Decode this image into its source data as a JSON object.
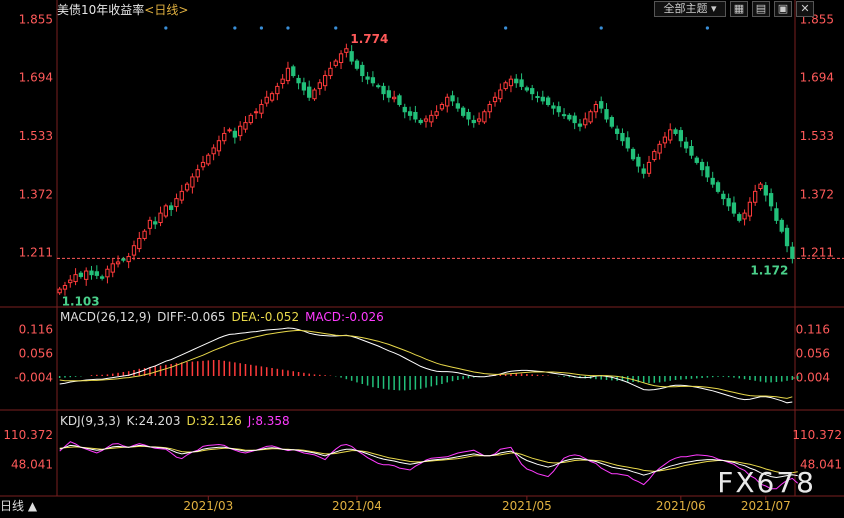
{
  "header": {
    "title": "美债10年收益率",
    "period": "<日线>"
  },
  "toolbar": {
    "dropdown_label": "全部主题",
    "icons": [
      "grid-icon",
      "list-icon",
      "expand-icon",
      "close-icon"
    ]
  },
  "colors": {
    "up": "#ff3b3b",
    "down": "#22c07a",
    "diff": "#ffffff",
    "dea": "#e8d84a",
    "macd": "#ff3bff",
    "k": "#ffffff",
    "d": "#e8d84a",
    "j": "#ff3bff",
    "dashed": "#ff5a5a",
    "marker": "#3a8fd8"
  },
  "macd": {
    "title": "MACD(26,12,9)",
    "diff_label": "DIFF:-0.065",
    "dea_label": "DEA:-0.052",
    "macd_label": "MACD:-0.026"
  },
  "kdj": {
    "title": "KDJ(9,3,3)",
    "k_label": "K:24.203",
    "d_label": "D:32.126",
    "j_label": "J:8.358"
  },
  "footer": {
    "label": "日线 ▲"
  },
  "watermark": "FX678",
  "chart_data": {
    "type": "candlestick",
    "title": "美债10年收益率",
    "y_ticks": [
      "1.855",
      "1.694",
      "1.533",
      "1.372",
      "1.211"
    ],
    "ylim": [
      1.08,
      1.87
    ],
    "x_tick_labels": [
      "2021/03",
      "2021/04",
      "2021/05",
      "2021/06",
      "2021/07"
    ],
    "high_label": "1.774",
    "low_label": "1.103",
    "last_label": "1.172",
    "last_value": 1.195,
    "closes": [
      1.11,
      1.12,
      1.135,
      1.15,
      1.145,
      1.16,
      1.15,
      1.148,
      1.14,
      1.165,
      1.18,
      1.185,
      1.19,
      1.2,
      1.23,
      1.25,
      1.27,
      1.3,
      1.29,
      1.32,
      1.34,
      1.33,
      1.36,
      1.38,
      1.4,
      1.42,
      1.44,
      1.46,
      1.48,
      1.5,
      1.52,
      1.54,
      1.55,
      1.53,
      1.56,
      1.57,
      1.59,
      1.6,
      1.62,
      1.64,
      1.65,
      1.67,
      1.69,
      1.72,
      1.7,
      1.68,
      1.66,
      1.64,
      1.66,
      1.68,
      1.7,
      1.72,
      1.74,
      1.76,
      1.774,
      1.74,
      1.72,
      1.7,
      1.69,
      1.68,
      1.67,
      1.65,
      1.64,
      1.64,
      1.62,
      1.6,
      1.59,
      1.58,
      1.57,
      1.58,
      1.59,
      1.6,
      1.62,
      1.64,
      1.63,
      1.61,
      1.59,
      1.58,
      1.57,
      1.58,
      1.6,
      1.62,
      1.64,
      1.66,
      1.68,
      1.69,
      1.68,
      1.67,
      1.66,
      1.65,
      1.64,
      1.63,
      1.62,
      1.61,
      1.6,
      1.59,
      1.58,
      1.57,
      1.56,
      1.58,
      1.6,
      1.62,
      1.61,
      1.58,
      1.56,
      1.54,
      1.52,
      1.5,
      1.47,
      1.45,
      1.43,
      1.46,
      1.49,
      1.51,
      1.53,
      1.55,
      1.54,
      1.52,
      1.5,
      1.48,
      1.46,
      1.44,
      1.42,
      1.4,
      1.38,
      1.36,
      1.34,
      1.32,
      1.3,
      1.32,
      1.35,
      1.38,
      1.4,
      1.37,
      1.34,
      1.3,
      1.27,
      1.23,
      1.195
    ],
    "macd_y_ticks": [
      "0.116",
      "0.056",
      "-0.004"
    ],
    "macd_ylim": [
      -0.07,
      0.135
    ],
    "macd_diff": [
      -0.02,
      -0.018,
      -0.015,
      -0.013,
      -0.012,
      -0.01,
      -0.009,
      -0.008,
      -0.008,
      -0.006,
      -0.004,
      -0.002,
      0.0,
      0.002,
      0.006,
      0.01,
      0.015,
      0.021,
      0.025,
      0.031,
      0.037,
      0.041,
      0.047,
      0.053,
      0.059,
      0.065,
      0.071,
      0.077,
      0.083,
      0.089,
      0.095,
      0.1,
      0.104,
      0.105,
      0.107,
      0.108,
      0.11,
      0.111,
      0.113,
      0.115,
      0.116,
      0.117,
      0.118,
      0.12,
      0.119,
      0.116,
      0.112,
      0.107,
      0.104,
      0.102,
      0.101,
      0.1,
      0.1,
      0.101,
      0.102,
      0.099,
      0.095,
      0.09,
      0.085,
      0.08,
      0.075,
      0.069,
      0.063,
      0.058,
      0.052,
      0.045,
      0.038,
      0.031,
      0.024,
      0.019,
      0.015,
      0.012,
      0.011,
      0.011,
      0.01,
      0.008,
      0.005,
      0.002,
      -0.001,
      -0.002,
      -0.002,
      0.0,
      0.002,
      0.005,
      0.009,
      0.012,
      0.013,
      0.014,
      0.014,
      0.013,
      0.012,
      0.011,
      0.009,
      0.007,
      0.005,
      0.003,
      0.001,
      -0.002,
      -0.004,
      -0.004,
      -0.003,
      0.0,
      0.001,
      -0.001,
      -0.003,
      -0.007,
      -0.011,
      -0.016,
      -0.022,
      -0.028,
      -0.034,
      -0.035,
      -0.034,
      -0.032,
      -0.029,
      -0.025,
      -0.023,
      -0.023,
      -0.024,
      -0.026,
      -0.028,
      -0.031,
      -0.034,
      -0.037,
      -0.041,
      -0.045,
      -0.049,
      -0.053,
      -0.057,
      -0.059,
      -0.058,
      -0.055,
      -0.052,
      -0.052,
      -0.054,
      -0.058,
      -0.062,
      -0.067,
      -0.065
    ],
    "macd_dea": [
      -0.01,
      -0.012,
      -0.012,
      -0.012,
      -0.012,
      -0.012,
      -0.011,
      -0.011,
      -0.01,
      -0.009,
      -0.008,
      -0.007,
      -0.005,
      -0.004,
      -0.002,
      0.0,
      0.003,
      0.006,
      0.01,
      0.014,
      0.018,
      0.022,
      0.027,
      0.032,
      0.037,
      0.042,
      0.047,
      0.052,
      0.058,
      0.064,
      0.069,
      0.074,
      0.08,
      0.084,
      0.088,
      0.091,
      0.095,
      0.098,
      0.101,
      0.104,
      0.106,
      0.108,
      0.11,
      0.112,
      0.113,
      0.114,
      0.113,
      0.112,
      0.11,
      0.108,
      0.106,
      0.104,
      0.102,
      0.101,
      0.101,
      0.1,
      0.098,
      0.096,
      0.093,
      0.09,
      0.087,
      0.083,
      0.079,
      0.074,
      0.069,
      0.064,
      0.059,
      0.053,
      0.048,
      0.042,
      0.037,
      0.032,
      0.028,
      0.025,
      0.022,
      0.019,
      0.016,
      0.013,
      0.01,
      0.008,
      0.006,
      0.005,
      0.004,
      0.004,
      0.005,
      0.006,
      0.007,
      0.008,
      0.009,
      0.01,
      0.01,
      0.01,
      0.01,
      0.01,
      0.009,
      0.008,
      0.007,
      0.005,
      0.003,
      0.002,
      0.001,
      0.001,
      0.001,
      0.001,
      0.0,
      -0.001,
      -0.003,
      -0.006,
      -0.009,
      -0.013,
      -0.017,
      -0.021,
      -0.024,
      -0.026,
      -0.027,
      -0.027,
      -0.027,
      -0.026,
      -0.026,
      -0.026,
      -0.026,
      -0.027,
      -0.028,
      -0.03,
      -0.032,
      -0.035,
      -0.038,
      -0.041,
      -0.044,
      -0.047,
      -0.049,
      -0.05,
      -0.05,
      -0.05,
      -0.051,
      -0.052,
      -0.054,
      -0.056,
      -0.052
    ],
    "macd_hist": [
      -0.005,
      -0.004,
      -0.003,
      -0.002,
      -0.001,
      0.0,
      0.002,
      0.003,
      0.003,
      0.004,
      0.006,
      0.008,
      0.01,
      0.012,
      0.015,
      0.018,
      0.02,
      0.022,
      0.024,
      0.026,
      0.028,
      0.03,
      0.032,
      0.034,
      0.035,
      0.036,
      0.037,
      0.038,
      0.039,
      0.04,
      0.04,
      0.038,
      0.036,
      0.034,
      0.032,
      0.03,
      0.028,
      0.026,
      0.024,
      0.022,
      0.02,
      0.018,
      0.016,
      0.014,
      0.012,
      0.01,
      0.008,
      0.006,
      0.004,
      0.003,
      0.002,
      0.001,
      -0.001,
      -0.004,
      -0.008,
      -0.012,
      -0.016,
      -0.02,
      -0.024,
      -0.028,
      -0.03,
      -0.032,
      -0.034,
      -0.035,
      -0.036,
      -0.036,
      -0.035,
      -0.034,
      -0.032,
      -0.029,
      -0.026,
      -0.023,
      -0.02,
      -0.016,
      -0.013,
      -0.01,
      -0.008,
      -0.006,
      -0.004,
      -0.002,
      0.0,
      0.002,
      0.003,
      0.004,
      0.005,
      0.006,
      0.007,
      0.006,
      0.005,
      0.004,
      0.003,
      0.002,
      0.001,
      0.0,
      -0.001,
      -0.002,
      -0.003,
      -0.004,
      -0.005,
      -0.006,
      -0.007,
      -0.008,
      -0.009,
      -0.01,
      -0.011,
      -0.012,
      -0.013,
      -0.014,
      -0.015,
      -0.016,
      -0.017,
      -0.018,
      -0.017,
      -0.016,
      -0.014,
      -0.012,
      -0.01,
      -0.009,
      -0.008,
      -0.007,
      -0.006,
      -0.005,
      -0.004,
      -0.003,
      -0.002,
      -0.002,
      -0.003,
      -0.004,
      -0.006,
      -0.008,
      -0.01,
      -0.012,
      -0.014,
      -0.016,
      -0.016,
      -0.015,
      -0.014,
      -0.012,
      -0.01,
      -0.008
    ],
    "kdj_y_ticks": [
      "110.372",
      "48.041"
    ],
    "kdj_ylim": [
      -15,
      125
    ],
    "kdj_k": [
      80,
      84,
      88,
      87,
      84,
      82,
      80,
      78,
      79,
      82,
      85,
      86,
      85,
      84,
      86,
      88,
      87,
      85,
      84,
      83,
      82,
      78,
      73,
      70,
      72,
      74,
      76,
      80,
      82,
      83,
      84,
      84,
      82,
      80,
      78,
      76,
      77,
      78,
      80,
      82,
      83,
      82,
      80,
      79,
      79,
      78,
      76,
      74,
      72,
      69,
      66,
      70,
      74,
      78,
      80,
      80,
      77,
      74,
      70,
      66,
      62,
      59,
      57,
      55,
      52,
      50,
      48,
      50,
      52,
      55,
      57,
      58,
      59,
      60,
      62,
      64,
      66,
      68,
      70,
      68,
      66,
      66,
      68,
      72,
      74,
      76,
      70,
      62,
      56,
      52,
      48,
      45,
      42,
      45,
      50,
      55,
      58,
      60,
      60,
      58,
      56,
      54,
      50,
      46,
      42,
      40,
      38,
      36,
      32,
      29,
      25,
      28,
      32,
      36,
      40,
      44,
      47,
      50,
      52,
      54,
      56,
      57,
      58,
      58,
      57,
      56,
      54,
      52,
      48,
      45,
      40,
      36,
      30,
      26,
      22,
      20,
      22,
      24,
      26,
      24
    ],
    "kdj_d": [
      82,
      83,
      84,
      85,
      84,
      83,
      82,
      81,
      80,
      81,
      82,
      83,
      84,
      84,
      85,
      86,
      86,
      85,
      85,
      84,
      83,
      81,
      78,
      75,
      74,
      74,
      75,
      77,
      79,
      80,
      81,
      82,
      82,
      81,
      80,
      78,
      78,
      78,
      79,
      80,
      81,
      81,
      80,
      80,
      79,
      79,
      78,
      76,
      74,
      72,
      70,
      70,
      71,
      73,
      75,
      77,
      77,
      76,
      74,
      71,
      68,
      65,
      62,
      60,
      58,
      56,
      54,
      53,
      53,
      54,
      55,
      56,
      57,
      58,
      59,
      60,
      62,
      64,
      66,
      66,
      66,
      66,
      67,
      68,
      70,
      72,
      72,
      69,
      65,
      61,
      58,
      55,
      52,
      51,
      51,
      52,
      54,
      56,
      57,
      57,
      57,
      56,
      55,
      52,
      49,
      46,
      44,
      42,
      40,
      38,
      35,
      34,
      33,
      34,
      36,
      38,
      40,
      43,
      46,
      48,
      50,
      52,
      54,
      55,
      56,
      56,
      55,
      54,
      52,
      50,
      48,
      45,
      42,
      38,
      35,
      32,
      30,
      29,
      30,
      32
    ],
    "kdj_j": [
      76,
      86,
      96,
      91,
      84,
      80,
      76,
      72,
      77,
      84,
      91,
      92,
      87,
      84,
      88,
      92,
      89,
      85,
      82,
      81,
      80,
      72,
      63,
      60,
      68,
      74,
      78,
      86,
      88,
      89,
      90,
      88,
      82,
      78,
      74,
      72,
      75,
      78,
      82,
      86,
      87,
      84,
      80,
      77,
      79,
      76,
      72,
      70,
      68,
      63,
      58,
      70,
      80,
      88,
      90,
      86,
      77,
      70,
      62,
      56,
      50,
      47,
      47,
      45,
      40,
      38,
      36,
      44,
      50,
      57,
      61,
      62,
      63,
      64,
      68,
      72,
      74,
      76,
      78,
      72,
      66,
      66,
      70,
      80,
      82,
      84,
      66,
      48,
      38,
      34,
      28,
      25,
      22,
      33,
      48,
      61,
      66,
      68,
      66,
      60,
      54,
      50,
      40,
      34,
      28,
      28,
      26,
      24,
      16,
      11,
      5,
      16,
      30,
      40,
      48,
      56,
      61,
      64,
      64,
      66,
      68,
      67,
      66,
      64,
      59,
      56,
      52,
      48,
      40,
      35,
      24,
      18,
      6,
      2,
      -4,
      -4,
      6,
      14,
      18,
      8
    ]
  }
}
